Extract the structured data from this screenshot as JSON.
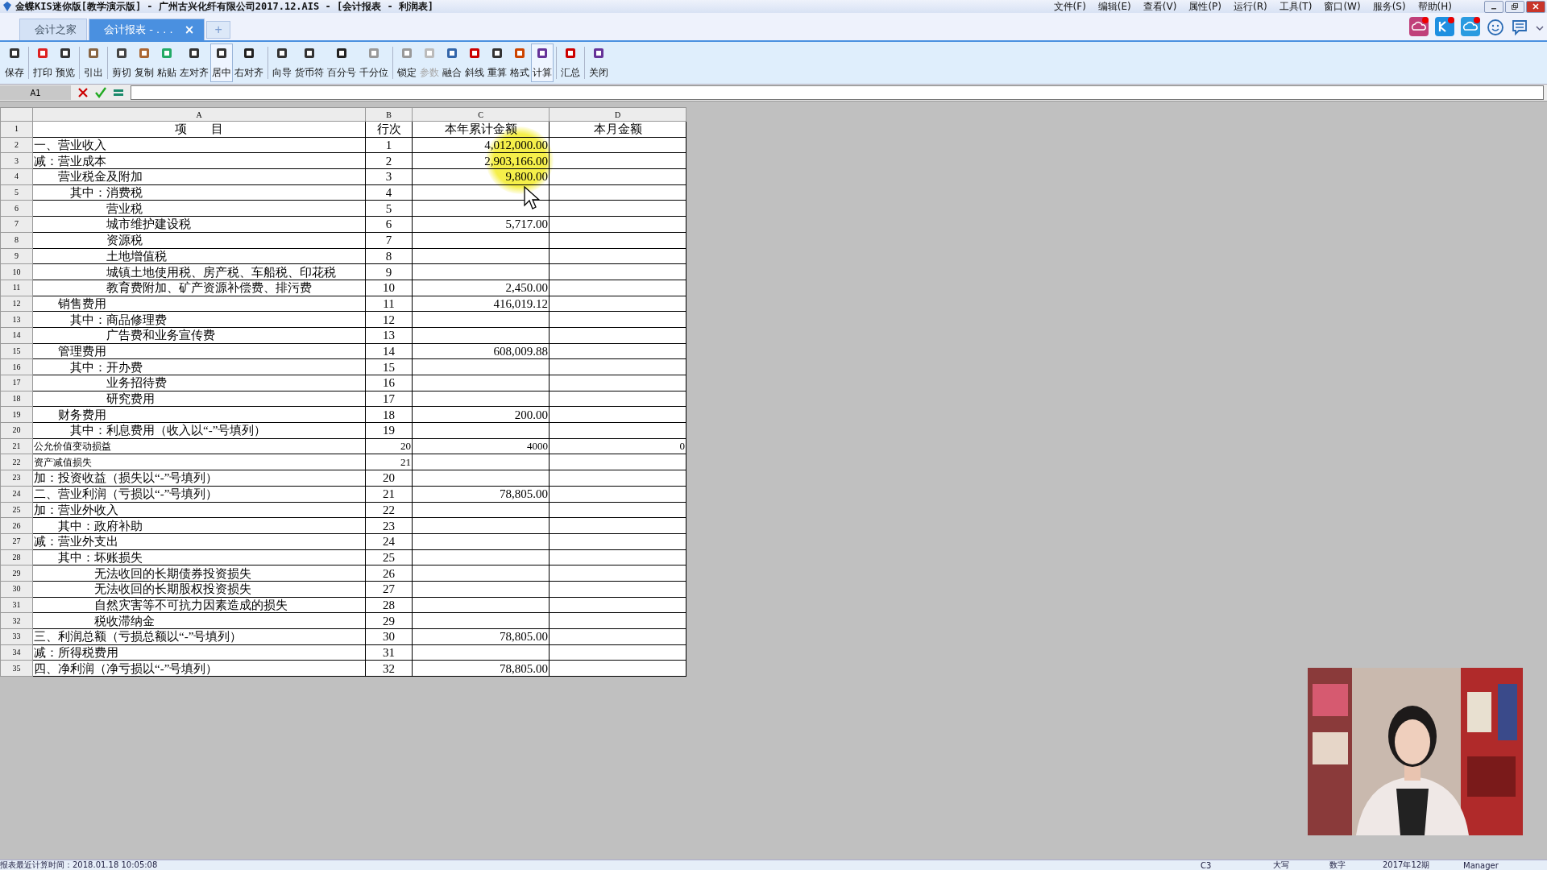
{
  "window": {
    "title": "金蝶KIS迷你版[教学演示版] - 广州古兴化纤有限公司2017.12.AIS - [会计报表 - 利润表]"
  },
  "menu": [
    "文件(F)",
    "编辑(E)",
    "查看(V)",
    "属性(P)",
    "运行(R)",
    "工具(T)",
    "窗口(W)",
    "服务(S)",
    "帮助(H)"
  ],
  "tabs": [
    {
      "label": "会计之家",
      "selected": false
    },
    {
      "label": "会计报表 - . . .",
      "selected": true,
      "close": "×"
    }
  ],
  "new_tab": "+",
  "toolbar": [
    [
      {
        "label": "保存",
        "selected": false,
        "disabled": false
      }
    ],
    [
      {
        "label": "打印",
        "selected": false,
        "disabled": false
      },
      {
        "label": "预览",
        "selected": false,
        "disabled": false
      }
    ],
    [
      {
        "label": "引出",
        "selected": false,
        "disabled": false
      }
    ],
    [
      {
        "label": "剪切",
        "selected": false,
        "disabled": false
      },
      {
        "label": "复制",
        "selected": false,
        "disabled": false
      },
      {
        "label": "粘贴",
        "selected": false,
        "disabled": false
      },
      {
        "label": "左对齐",
        "selected": false,
        "disabled": false
      },
      {
        "label": "居中",
        "selected": true,
        "disabled": false
      },
      {
        "label": "右对齐",
        "selected": false,
        "disabled": false
      }
    ],
    [
      {
        "label": "向导",
        "selected": false,
        "disabled": false
      },
      {
        "label": "货币符",
        "selected": false,
        "disabled": false
      },
      {
        "label": "百分号",
        "selected": false,
        "disabled": false
      },
      {
        "label": "千分位",
        "selected": false,
        "disabled": false
      }
    ],
    [
      {
        "label": "锁定",
        "selected": false,
        "disabled": false
      },
      {
        "label": "参数",
        "selected": false,
        "disabled": true
      },
      {
        "label": "融合",
        "selected": false,
        "disabled": false
      },
      {
        "label": "斜线",
        "selected": false,
        "disabled": false
      },
      {
        "label": "重算",
        "selected": false,
        "disabled": false
      },
      {
        "label": "格式",
        "selected": false,
        "disabled": false
      },
      {
        "label": "计算",
        "selected": true,
        "disabled": false
      }
    ],
    [
      {
        "label": "汇总",
        "selected": false,
        "disabled": false
      }
    ],
    [
      {
        "label": "关闭",
        "selected": false,
        "disabled": false
      }
    ]
  ],
  "formula_bar": {
    "cell": "A1"
  },
  "sheet": {
    "columns": [
      "A",
      "B",
      "C",
      "D"
    ],
    "rows": [
      {
        "num": "1",
        "kind": "header",
        "a": "项　　目",
        "b": "行次",
        "c": "本年累计金额",
        "d": "本月金额"
      },
      {
        "num": "2",
        "kind": "normal",
        "a": "一、营业收入",
        "b": "1",
        "c": "4,012,000.00",
        "d": ""
      },
      {
        "num": "3",
        "kind": "normal",
        "a": "减：营业成本",
        "b": "2",
        "c": "2,903,166.00",
        "d": ""
      },
      {
        "num": "4",
        "kind": "normal",
        "a": "　　营业税金及附加",
        "b": "3",
        "c": "9,800.00",
        "d": ""
      },
      {
        "num": "5",
        "kind": "normal",
        "a": "　　　其中：消费税",
        "b": "4",
        "c": "",
        "d": ""
      },
      {
        "num": "6",
        "kind": "normal",
        "a": "　　　　　　营业税",
        "b": "5",
        "c": "",
        "d": ""
      },
      {
        "num": "7",
        "kind": "normal",
        "a": "　　　　　　城市维护建设税",
        "b": "6",
        "c": "5,717.00",
        "d": ""
      },
      {
        "num": "8",
        "kind": "normal",
        "a": "　　　　　　资源税",
        "b": "7",
        "c": "",
        "d": ""
      },
      {
        "num": "9",
        "kind": "normal",
        "a": "　　　　　　土地增值税",
        "b": "8",
        "c": "",
        "d": ""
      },
      {
        "num": "10",
        "kind": "normal",
        "a": "　　　　　　城镇土地使用税、房产税、车船税、印花税",
        "b": "9",
        "c": "",
        "d": ""
      },
      {
        "num": "11",
        "kind": "normal",
        "a": "　　　　　　教育费附加、矿产资源补偿费、排污费",
        "b": "10",
        "c": "2,450.00",
        "d": ""
      },
      {
        "num": "12",
        "kind": "normal",
        "a": "　　销售费用",
        "b": "11",
        "c": "416,019.12",
        "d": ""
      },
      {
        "num": "13",
        "kind": "normal",
        "a": "　　　其中：商品修理费",
        "b": "12",
        "c": "",
        "d": ""
      },
      {
        "num": "14",
        "kind": "normal",
        "a": "　　　　　　广告费和业务宣传费",
        "b": "13",
        "c": "",
        "d": ""
      },
      {
        "num": "15",
        "kind": "normal",
        "a": "　　管理费用",
        "b": "14",
        "c": "608,009.88",
        "d": ""
      },
      {
        "num": "16",
        "kind": "normal",
        "a": "　　　其中：开办费",
        "b": "15",
        "c": "",
        "d": ""
      },
      {
        "num": "17",
        "kind": "normal",
        "a": "　　　　　　业务招待费",
        "b": "16",
        "c": "",
        "d": ""
      },
      {
        "num": "18",
        "kind": "normal",
        "a": "　　　　　　研究费用",
        "b": "17",
        "c": "",
        "d": ""
      },
      {
        "num": "19",
        "kind": "normal",
        "a": "　　财务费用",
        "b": "18",
        "c": "200.00",
        "d": ""
      },
      {
        "num": "20",
        "kind": "normal",
        "a": "　　　其中：利息费用（收入以“-”号填列）",
        "b": "19",
        "c": "",
        "d": ""
      },
      {
        "num": "21",
        "kind": "small",
        "a": "公允价值变动损益",
        "b": "20",
        "c": "4000",
        "d": "0"
      },
      {
        "num": "22",
        "kind": "small",
        "a": "资产减值损失",
        "b": "21",
        "c": "",
        "d": ""
      },
      {
        "num": "23",
        "kind": "normal",
        "a": "加：投资收益（损失以“-”号填列）",
        "b": "20",
        "c": "",
        "d": ""
      },
      {
        "num": "24",
        "kind": "normal",
        "a": "二、营业利润（亏损以“-”号填列）",
        "b": "21",
        "c": "78,805.00",
        "d": ""
      },
      {
        "num": "25",
        "kind": "normal",
        "a": "加：营业外收入",
        "b": "22",
        "c": "",
        "d": ""
      },
      {
        "num": "26",
        "kind": "normal",
        "a": "　　其中：政府补助",
        "b": "23",
        "c": "",
        "d": ""
      },
      {
        "num": "27",
        "kind": "normal",
        "a": "减：营业外支出",
        "b": "24",
        "c": "",
        "d": ""
      },
      {
        "num": "28",
        "kind": "normal",
        "a": "　　其中：坏账损失",
        "b": "25",
        "c": "",
        "d": ""
      },
      {
        "num": "29",
        "kind": "normal",
        "a": "　　　　　无法收回的长期债券投资损失",
        "b": "26",
        "c": "",
        "d": ""
      },
      {
        "num": "30",
        "kind": "normal",
        "a": "　　　　　无法收回的长期股权投资损失",
        "b": "27",
        "c": "",
        "d": ""
      },
      {
        "num": "31",
        "kind": "normal",
        "a": "　　　　　自然灾害等不可抗力因素造成的损失",
        "b": "28",
        "c": "",
        "d": ""
      },
      {
        "num": "32",
        "kind": "normal",
        "a": "　　　　　税收滞纳金",
        "b": "29",
        "c": "",
        "d": ""
      },
      {
        "num": "33",
        "kind": "normal",
        "a": "三、利润总额（亏损总额以“-”号填列）",
        "b": "30",
        "c": "78,805.00",
        "d": ""
      },
      {
        "num": "34",
        "kind": "normal",
        "a": "减：所得税费用",
        "b": "31",
        "c": "",
        "d": ""
      },
      {
        "num": "35",
        "kind": "normal",
        "a": "四、净利润（净亏损以“-”号填列）",
        "b": "32",
        "c": "78,805.00",
        "d": ""
      }
    ]
  },
  "video_overlay": {
    "kind": "picture"
  },
  "status_bar": [
    "报表最近计算时间：2018.01.18 10:05:08",
    "C3",
    "大写",
    "数字",
    "2017年12期",
    "Manager"
  ]
}
